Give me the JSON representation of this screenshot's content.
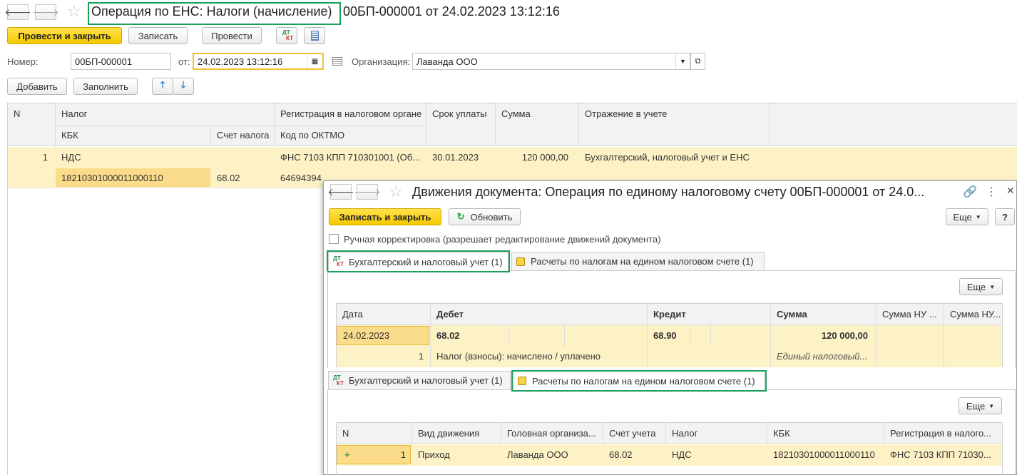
{
  "main": {
    "title_highlighted": "Операция по ЕНС: Налоги (начисление)",
    "title_rest": "00БП-000001 от 24.02.2023 13:12:16",
    "toolbar": {
      "post_close": "Провести и закрыть",
      "save": "Записать",
      "post": "Провести"
    },
    "number_label": "Номер:",
    "number_value": "00БП-000001",
    "date_label": "от:",
    "date_value": "24.02.2023 13:12:16",
    "org_label": "Организация:",
    "org_value": "Лаванда ООО",
    "add": "Добавить",
    "fill": "Заполнить",
    "table": {
      "headers": {
        "n": "N",
        "tax": "Налог",
        "kbk": "КБК",
        "tax_account": "Счет налога",
        "reg": "Регистрация в налоговом органе",
        "oktmo": "Код по ОКТМО",
        "due": "Срок уплаты",
        "sum": "Сумма",
        "reflect": "Отражение в учете"
      },
      "row": {
        "n": "1",
        "tax": "НДС",
        "kbk": "18210301000011000110",
        "tax_account": "68.02",
        "reg": "ФНС 7103 КПП 710301001 (Об...",
        "oktmo": "64694394",
        "due": "30.01.2023",
        "sum": "120 000,00",
        "reflect": "Бухгалтерский, налоговый учет и ЕНС"
      }
    }
  },
  "dialog": {
    "title": "Движения документа: Операция по единому налоговому счету 00БП-000001 от 24.0...",
    "save_close": "Записать и закрыть",
    "refresh": "Обновить",
    "more": "Еще",
    "help": "?",
    "manual_correction": "Ручная корректировка (разрешает редактирование движений документа)",
    "tab_accounting": "Бухгалтерский и налоговый учет (1)",
    "tab_ens": "Расчеты по налогам на едином налоговом счете (1)",
    "accounting_table": {
      "headers": {
        "date": "Дата",
        "debit": "Дебет",
        "credit": "Кредит",
        "sum": "Сумма",
        "sum_nu1": "Сумма НУ ...",
        "sum_nu2": "Сумма НУ..."
      },
      "row": {
        "date": "24.02.2023",
        "debit": "68.02",
        "credit": "68.90",
        "sum": "120 000,00",
        "n": "1",
        "content": "Налог (взносы): начислено / уплачено",
        "sum_desc": "Единый налоговый..."
      }
    },
    "ens_table": {
      "headers": {
        "n": "N",
        "kind": "Вид движения",
        "head_org": "Головная организа...",
        "account": "Счет учета",
        "tax": "Налог",
        "kbk": "КБК",
        "reg": "Регистрация в налого..."
      },
      "row": {
        "n": "1",
        "kind": "Приход",
        "head_org": "Лаванда ООО",
        "account": "68.02",
        "tax": "НДС",
        "kbk": "18210301000011000110",
        "reg": "ФНС 7103 КПП 71030..."
      }
    }
  }
}
